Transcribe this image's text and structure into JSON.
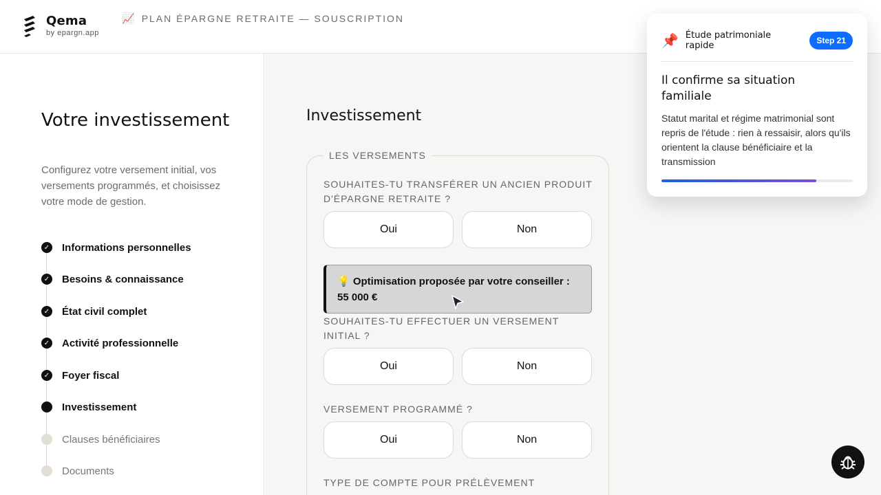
{
  "header": {
    "brand_name": "Qema",
    "brand_sub": "by epargn.app",
    "app_icon": "chart-increasing-icon",
    "app_title": "PLAN ÉPARGNE RETRAITE — SOUSCRIPTION"
  },
  "sidebar": {
    "title": "Votre investissement",
    "description": "Configurez votre versement initial, vos versements programmés, et choisissez votre mode de gestion.",
    "steps": [
      {
        "label": "Informations personnelles",
        "status": "done"
      },
      {
        "label": "Besoins & connaissance",
        "status": "done"
      },
      {
        "label": "État civil complet",
        "status": "done"
      },
      {
        "label": "Activité professionnelle",
        "status": "done"
      },
      {
        "label": "Foyer fiscal",
        "status": "done"
      },
      {
        "label": "Investissement",
        "status": "current"
      },
      {
        "label": "Clauses bénéficiaires",
        "status": "pending"
      },
      {
        "label": "Documents",
        "status": "pending"
      }
    ]
  },
  "main": {
    "title": "Investissement",
    "section_legend": "LES VERSEMENTS",
    "questions": [
      {
        "label": "SOUHAITES-TU TRANSFÉRER UN ANCIEN PRODUIT D'ÉPARGNE RETRAITE ?",
        "yes": "Oui",
        "no": "Non"
      },
      {
        "label": "SOUHAITES-TU EFFECTUER UN VERSEMENT INITIAL ?",
        "yes": "Oui",
        "no": "Non"
      },
      {
        "label": "VERSEMENT PROGRAMMÉ ?",
        "yes": "Oui",
        "no": "Non"
      },
      {
        "label": "TYPE DE COMPTE POUR PRÉLÈVEMENT"
      }
    ],
    "hint": "💡 Optimisation proposée par votre conseiller : 55 000 €"
  },
  "popover": {
    "icon": "pushpin-icon",
    "header_title": "Étude patrimoniale rapide",
    "badge": "Step 21",
    "title": "Il confirme sa situation familiale",
    "body": "Statut marital et régime matrimonial sont repris de l'étude : rien à ressaisir, alors qu'ils orientent la clause bénéficiaire et la transmission",
    "progress_percent": 81
  },
  "colors": {
    "accent": "#0d6efd",
    "text": "#111111",
    "muted": "#6c6c6c",
    "main_bg": "#f6f6f5"
  }
}
